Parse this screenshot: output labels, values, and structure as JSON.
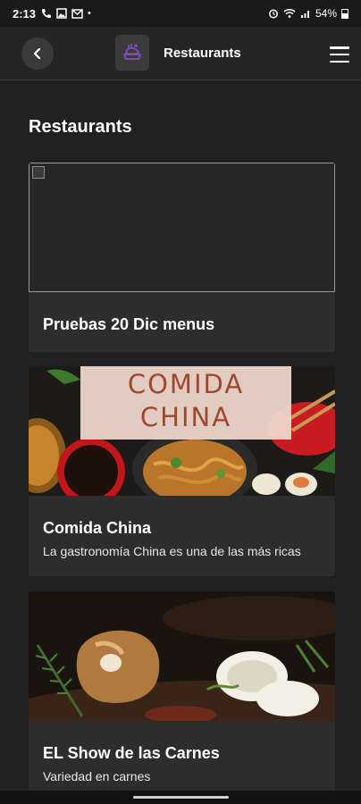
{
  "status_bar": {
    "time": "2:13",
    "battery": "54%"
  },
  "app_bar": {
    "title": "Restaurants",
    "back_icon": "chevron-left-icon",
    "menu_icon": "hamburger-menu-icon",
    "logo_icon": "restaurant-logo-icon"
  },
  "page": {
    "title": "Restaurants"
  },
  "restaurants": [
    {
      "name": "Pruebas 20 Dic menus",
      "description": "",
      "image": "broken-image"
    },
    {
      "name": "Comida China",
      "description": "La gastronomía China es una de las más ricas",
      "image": "chinese-food-photo",
      "banner_text_line1": "COMIDA",
      "banner_text_line2": "CHINA"
    },
    {
      "name": "EL Show de las Carnes",
      "description": "Variedad en carnes",
      "image": "grilled-meat-photo"
    }
  ],
  "colors": {
    "background": "#212121",
    "card": "#2d2d2d",
    "accent_purple": "#7d4fc2"
  }
}
